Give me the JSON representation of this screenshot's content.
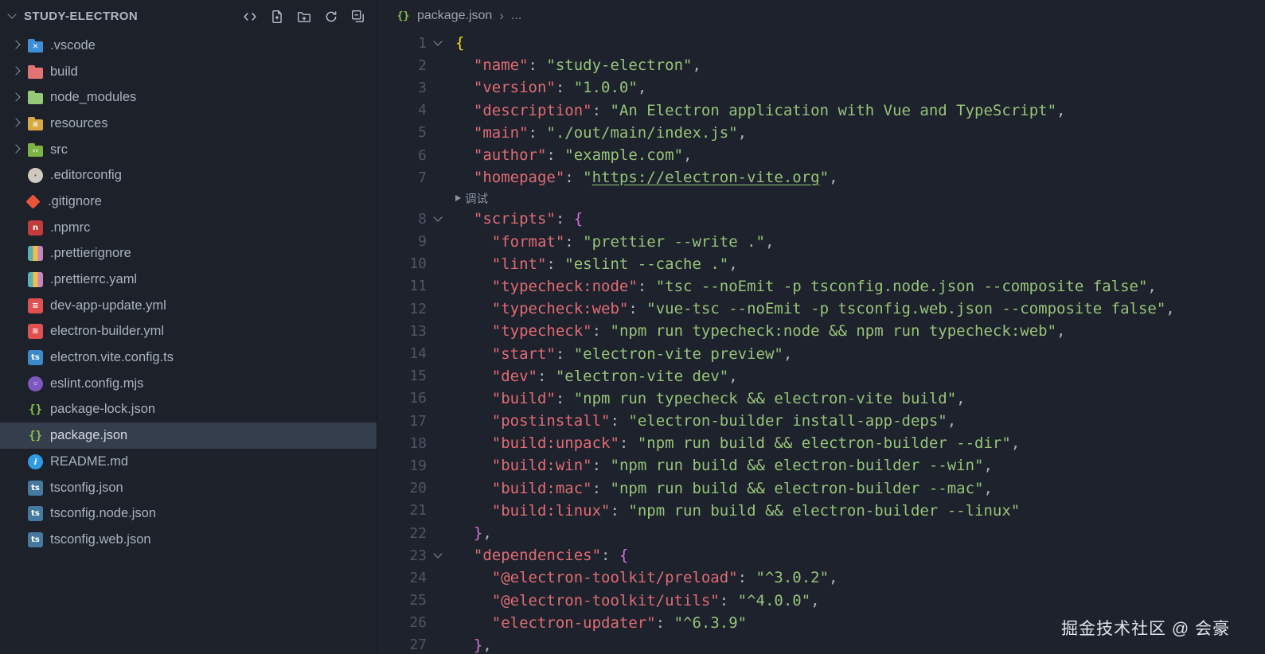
{
  "sidebar": {
    "title": "STUDY-ELECTRON",
    "selected": "package.json",
    "items": [
      {
        "label": ".vscode",
        "kind": "folder",
        "shape": "folder",
        "icon": "vscode-folder-icon",
        "color": "#3f8fd6",
        "glyph": "✕"
      },
      {
        "label": "build",
        "kind": "folder",
        "shape": "folder",
        "icon": "build-folder-icon",
        "color": "#e57373"
      },
      {
        "label": "node_modules",
        "kind": "folder",
        "shape": "folder",
        "icon": "node-modules-folder-icon",
        "color": "#97c878"
      },
      {
        "label": "resources",
        "kind": "folder",
        "shape": "folder",
        "icon": "resources-folder-icon",
        "color": "#d9a743",
        "glyph": "≡"
      },
      {
        "label": "src",
        "kind": "folder",
        "shape": "folder",
        "icon": "src-folder-icon",
        "color": "#7cb342",
        "glyph": "‹›"
      },
      {
        "label": ".editorconfig",
        "kind": "file",
        "shape": "circle",
        "icon": "editorconfig-icon",
        "color": "#cfc9bf",
        "fg": "#5a544c",
        "glyph": "·"
      },
      {
        "label": ".gitignore",
        "kind": "file",
        "shape": "diamond",
        "icon": "git-icon",
        "color": "#e8553a"
      },
      {
        "label": ".npmrc",
        "kind": "file",
        "shape": "square",
        "icon": "npm-icon",
        "color": "#c23c3c",
        "glyph": "n"
      },
      {
        "label": ".prettierignore",
        "kind": "file",
        "shape": "stripes",
        "icon": "prettier-icon"
      },
      {
        "label": ".prettierrc.yaml",
        "kind": "file",
        "shape": "stripes",
        "icon": "prettier-icon"
      },
      {
        "label": "dev-app-update.yml",
        "kind": "file",
        "shape": "square",
        "icon": "yaml-icon",
        "color": "#df5050",
        "glyph": "≡"
      },
      {
        "label": "electron-builder.yml",
        "kind": "file",
        "shape": "square",
        "icon": "yaml-icon",
        "color": "#df5050",
        "glyph": "≡"
      },
      {
        "label": "electron.vite.config.ts",
        "kind": "file",
        "shape": "square",
        "icon": "typescript-config-icon",
        "color": "#3b89c8",
        "glyph": "ts"
      },
      {
        "label": "eslint.config.mjs",
        "kind": "file",
        "shape": "circle",
        "icon": "eslint-icon",
        "color": "#7e57c2",
        "glyph": "◦"
      },
      {
        "label": "package-lock.json",
        "kind": "file",
        "shape": "glyph",
        "icon": "json-braces-icon",
        "color": "#8bc34a",
        "glyph": "{}"
      },
      {
        "label": "package.json",
        "kind": "file",
        "shape": "glyph",
        "icon": "json-braces-icon",
        "color": "#8bc34a",
        "glyph": "{}"
      },
      {
        "label": "README.md",
        "kind": "file",
        "shape": "circle",
        "icon": "readme-info-icon",
        "color": "#2e9be6",
        "glyph": "i"
      },
      {
        "label": "tsconfig.json",
        "kind": "file",
        "shape": "square",
        "icon": "tsconfig-icon",
        "color": "#46799f",
        "glyph": "ts"
      },
      {
        "label": "tsconfig.node.json",
        "kind": "file",
        "shape": "square",
        "icon": "tsconfig-icon",
        "color": "#46799f",
        "glyph": "ts"
      },
      {
        "label": "tsconfig.web.json",
        "kind": "file",
        "shape": "square",
        "icon": "tsconfig-icon",
        "color": "#46799f",
        "glyph": "ts"
      }
    ]
  },
  "editor": {
    "breadcrumb": {
      "icon_glyph": "{}",
      "file": "package.json",
      "separator": "›",
      "more": "..."
    },
    "watermark": "掘金技术社区 @ 会豪",
    "colors": {
      "k": "#e06c75",
      "s": "#98c379",
      "p": "#abb2bf",
      "b1": "#ffd700",
      "b2": "#d670d6",
      "u": "#98c379",
      "selection_bg": "#353e4c",
      "line_number": "#4d5667"
    },
    "lines": [
      {
        "n": 1,
        "f": 1,
        "t": [
          [
            "b1",
            "{"
          ]
        ]
      },
      {
        "n": 2,
        "t": [
          [
            "p",
            "  "
          ],
          [
            "k",
            "\"name\""
          ],
          [
            "p",
            ": "
          ],
          [
            "s",
            "\"study-electron\""
          ],
          [
            "p",
            ","
          ]
        ]
      },
      {
        "n": 3,
        "t": [
          [
            "p",
            "  "
          ],
          [
            "k",
            "\"version\""
          ],
          [
            "p",
            ": "
          ],
          [
            "s",
            "\"1.0.0\""
          ],
          [
            "p",
            ","
          ]
        ]
      },
      {
        "n": 4,
        "t": [
          [
            "p",
            "  "
          ],
          [
            "k",
            "\"description\""
          ],
          [
            "p",
            ": "
          ],
          [
            "s",
            "\"An Electron application with Vue and TypeScript\""
          ],
          [
            "p",
            ","
          ]
        ]
      },
      {
        "n": 5,
        "t": [
          [
            "p",
            "  "
          ],
          [
            "k",
            "\"main\""
          ],
          [
            "p",
            ": "
          ],
          [
            "s",
            "\"./out/main/index.js\""
          ],
          [
            "p",
            ","
          ]
        ]
      },
      {
        "n": 6,
        "t": [
          [
            "p",
            "  "
          ],
          [
            "k",
            "\"author\""
          ],
          [
            "p",
            ": "
          ],
          [
            "s",
            "\"example.com\""
          ],
          [
            "p",
            ","
          ]
        ]
      },
      {
        "n": 7,
        "t": [
          [
            "p",
            "  "
          ],
          [
            "k",
            "\"homepage\""
          ],
          [
            "p",
            ": "
          ],
          [
            "s",
            "\""
          ],
          [
            "u",
            "https://electron-vite.org"
          ],
          [
            "s",
            "\""
          ],
          [
            "p",
            ","
          ]
        ]
      },
      {
        "lens": "调试"
      },
      {
        "n": 8,
        "f": 1,
        "t": [
          [
            "p",
            "  "
          ],
          [
            "k",
            "\"scripts\""
          ],
          [
            "p",
            ": "
          ],
          [
            "b2",
            "{"
          ]
        ]
      },
      {
        "n": 9,
        "t": [
          [
            "p",
            "    "
          ],
          [
            "k",
            "\"format\""
          ],
          [
            "p",
            ": "
          ],
          [
            "s",
            "\"prettier --write .\""
          ],
          [
            "p",
            ","
          ]
        ]
      },
      {
        "n": 10,
        "t": [
          [
            "p",
            "    "
          ],
          [
            "k",
            "\"lint\""
          ],
          [
            "p",
            ": "
          ],
          [
            "s",
            "\"eslint --cache .\""
          ],
          [
            "p",
            ","
          ]
        ]
      },
      {
        "n": 11,
        "t": [
          [
            "p",
            "    "
          ],
          [
            "k",
            "\"typecheck:node\""
          ],
          [
            "p",
            ": "
          ],
          [
            "s",
            "\"tsc --noEmit -p tsconfig.node.json --composite false\""
          ],
          [
            "p",
            ","
          ]
        ]
      },
      {
        "n": 12,
        "t": [
          [
            "p",
            "    "
          ],
          [
            "k",
            "\"typecheck:web\""
          ],
          [
            "p",
            ": "
          ],
          [
            "s",
            "\"vue-tsc --noEmit -p tsconfig.web.json --composite false\""
          ],
          [
            "p",
            ","
          ]
        ]
      },
      {
        "n": 13,
        "t": [
          [
            "p",
            "    "
          ],
          [
            "k",
            "\"typecheck\""
          ],
          [
            "p",
            ": "
          ],
          [
            "s",
            "\"npm run typecheck:node && npm run typecheck:web\""
          ],
          [
            "p",
            ","
          ]
        ]
      },
      {
        "n": 14,
        "t": [
          [
            "p",
            "    "
          ],
          [
            "k",
            "\"start\""
          ],
          [
            "p",
            ": "
          ],
          [
            "s",
            "\"electron-vite preview\""
          ],
          [
            "p",
            ","
          ]
        ]
      },
      {
        "n": 15,
        "t": [
          [
            "p",
            "    "
          ],
          [
            "k",
            "\"dev\""
          ],
          [
            "p",
            ": "
          ],
          [
            "s",
            "\"electron-vite dev\""
          ],
          [
            "p",
            ","
          ]
        ]
      },
      {
        "n": 16,
        "t": [
          [
            "p",
            "    "
          ],
          [
            "k",
            "\"build\""
          ],
          [
            "p",
            ": "
          ],
          [
            "s",
            "\"npm run typecheck && electron-vite build\""
          ],
          [
            "p",
            ","
          ]
        ]
      },
      {
        "n": 17,
        "t": [
          [
            "p",
            "    "
          ],
          [
            "k",
            "\"postinstall\""
          ],
          [
            "p",
            ": "
          ],
          [
            "s",
            "\"electron-builder install-app-deps\""
          ],
          [
            "p",
            ","
          ]
        ]
      },
      {
        "n": 18,
        "t": [
          [
            "p",
            "    "
          ],
          [
            "k",
            "\"build:unpack\""
          ],
          [
            "p",
            ": "
          ],
          [
            "s",
            "\"npm run build && electron-builder --dir\""
          ],
          [
            "p",
            ","
          ]
        ]
      },
      {
        "n": 19,
        "t": [
          [
            "p",
            "    "
          ],
          [
            "k",
            "\"build:win\""
          ],
          [
            "p",
            ": "
          ],
          [
            "s",
            "\"npm run build && electron-builder --win\""
          ],
          [
            "p",
            ","
          ]
        ]
      },
      {
        "n": 20,
        "t": [
          [
            "p",
            "    "
          ],
          [
            "k",
            "\"build:mac\""
          ],
          [
            "p",
            ": "
          ],
          [
            "s",
            "\"npm run build && electron-builder --mac\""
          ],
          [
            "p",
            ","
          ]
        ]
      },
      {
        "n": 21,
        "t": [
          [
            "p",
            "    "
          ],
          [
            "k",
            "\"build:linux\""
          ],
          [
            "p",
            ": "
          ],
          [
            "s",
            "\"npm run build && electron-builder --linux\""
          ]
        ]
      },
      {
        "n": 22,
        "t": [
          [
            "p",
            "  "
          ],
          [
            "b2",
            "}"
          ],
          [
            "p",
            ","
          ]
        ]
      },
      {
        "n": 23,
        "f": 1,
        "t": [
          [
            "p",
            "  "
          ],
          [
            "k",
            "\"dependencies\""
          ],
          [
            "p",
            ": "
          ],
          [
            "b2",
            "{"
          ]
        ]
      },
      {
        "n": 24,
        "t": [
          [
            "p",
            "    "
          ],
          [
            "k",
            "\"@electron-toolkit/preload\""
          ],
          [
            "p",
            ": "
          ],
          [
            "s",
            "\"^3.0.2\""
          ],
          [
            "p",
            ","
          ]
        ]
      },
      {
        "n": 25,
        "t": [
          [
            "p",
            "    "
          ],
          [
            "k",
            "\"@electron-toolkit/utils\""
          ],
          [
            "p",
            ": "
          ],
          [
            "s",
            "\"^4.0.0\""
          ],
          [
            "p",
            ","
          ]
        ]
      },
      {
        "n": 26,
        "t": [
          [
            "p",
            "    "
          ],
          [
            "k",
            "\"electron-updater\""
          ],
          [
            "p",
            ": "
          ],
          [
            "s",
            "\"^6.3.9\""
          ]
        ]
      },
      {
        "n": 27,
        "t": [
          [
            "p",
            "  "
          ],
          [
            "b2",
            "}"
          ],
          [
            "p",
            ","
          ]
        ]
      }
    ]
  }
}
